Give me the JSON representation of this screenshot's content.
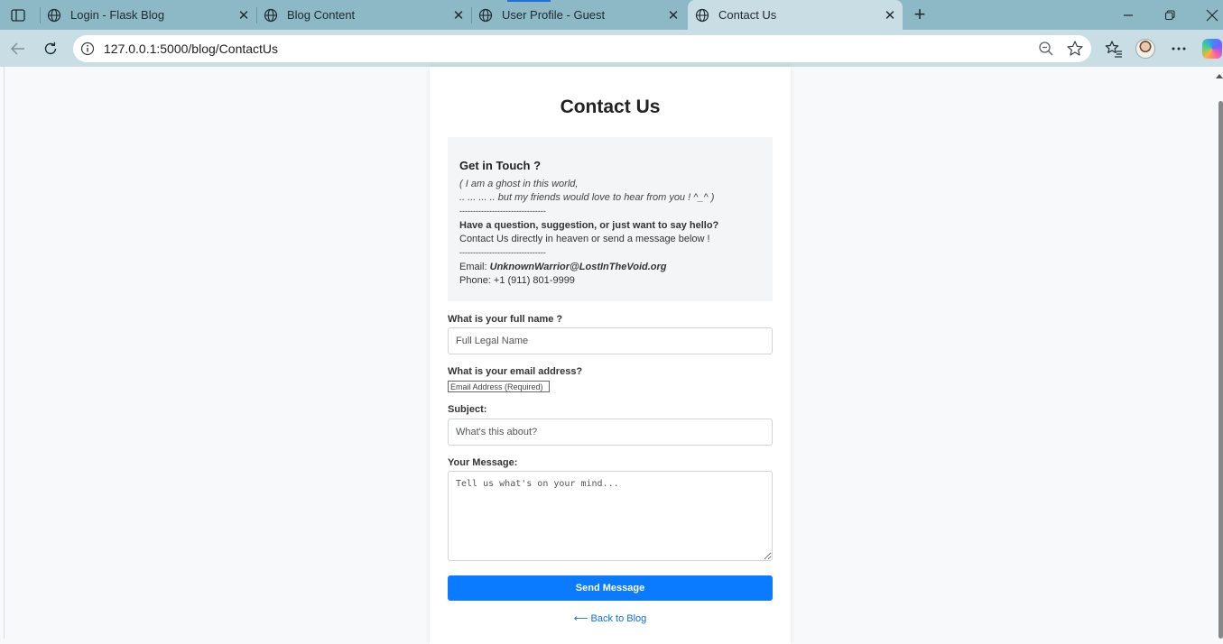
{
  "browser": {
    "tabs": [
      {
        "title": "Login - Flask Blog",
        "active": false
      },
      {
        "title": "Blog Content",
        "active": false
      },
      {
        "title": "User Profile - Guest",
        "active": false
      },
      {
        "title": "Contact Us",
        "active": true
      }
    ],
    "close_glyph": "✕",
    "new_tab_glyph": "+",
    "url": "127.0.0.1:5000/blog/ContactUs"
  },
  "page": {
    "title": "Contact Us",
    "info": {
      "heading": "Get in Touch ?",
      "line1": "( I am a ghost in this world,",
      "line2": ".. ... ... .. but my friends would love to hear from you ! ^_^ )",
      "divider": "--------------------------------",
      "question": "Have a question, suggestion, or just want to say hello?",
      "contact_line": "Contact Us directly in heaven or send a message below !",
      "email_label": "Email: ",
      "email": "UnknownWarrior@LostInTheVoid.org",
      "phone": "Phone: +1 (911) 801-9999"
    },
    "form": {
      "name_label": "What is your full name ?",
      "name_placeholder": "Full Legal Name",
      "email_label": "What is your email address?",
      "email_placeholder": "Email Address (Required)",
      "subject_label": "Subject:",
      "subject_placeholder": "What's this about?",
      "message_label": "Your Message:",
      "message_placeholder": "Tell us what's on your mind...",
      "submit_label": "Send Message",
      "back_label": "⟵ Back to Blog"
    }
  },
  "colors": {
    "tabstrip": "#8db8c6",
    "toolbar": "#c8dde4",
    "accent_button": "#0a7bff",
    "link": "#0a6fe0"
  }
}
